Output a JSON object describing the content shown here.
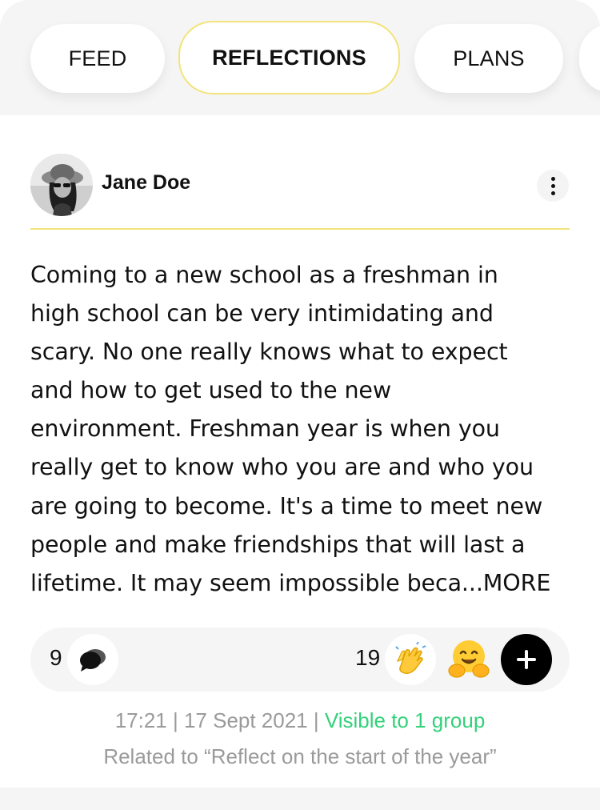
{
  "tabs": [
    {
      "label": "FEED",
      "active": false
    },
    {
      "label": "REFLECTIONS",
      "active": true
    },
    {
      "label": "PLANS",
      "active": false
    }
  ],
  "post": {
    "author": "Jane Doe",
    "body": "Coming to a new school as a freshman in\nhigh school can be very intimidating and\nscary. No one really knows what to expect\nand how to get used to the new\nenvironment. Freshman year is when you\nreally get to know who you are and who you\nare going to become. It's a time to meet new\npeople and make friendships that will last a\nlifetime. It may seem impossible beca...MORE",
    "comment_count": "9",
    "reaction_count": "19",
    "reactions": [
      "clapping-hands",
      "hugging-face"
    ],
    "timestamp": "17:21 | 17 Sept 2021 | ",
    "visibility": "Visible to 1 group",
    "related": "Related to “Reflect on the start of the year”"
  },
  "colors": {
    "accent_yellow": "#f2e37a",
    "visibility_green": "#33d17a",
    "meta_gray": "#9a9a9a"
  }
}
